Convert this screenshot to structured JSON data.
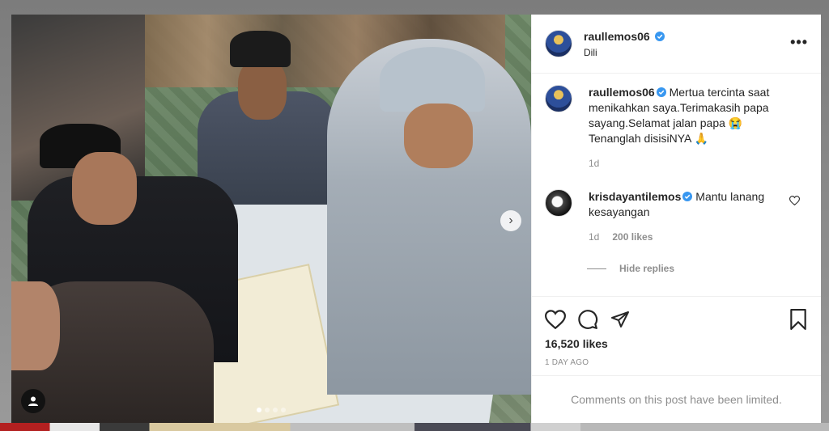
{
  "post": {
    "author": "raullemos06",
    "location": "Dili",
    "more_icon": "more-horizontal-icon",
    "carousel": {
      "dots": 4,
      "active_index": 0
    }
  },
  "caption": {
    "username": "raullemos06",
    "text": "Mertua tercinta saat menikahkan saya.Terimakasih papa sayang.Selamat jalan papa 😭 Tenanglah disisiNYA 🙏",
    "time": "1d"
  },
  "comment": {
    "username": "krisdayantilemos",
    "text": "Mantu lanang kesayangan",
    "time": "1d",
    "likes": "200 likes"
  },
  "hide_replies_label": "Hide replies",
  "actions": {
    "like_icon": "heart-icon",
    "comment_icon": "comment-icon",
    "share_icon": "share-icon",
    "save_icon": "bookmark-icon"
  },
  "likes_count": "16,520 likes",
  "posted_ago": "1 DAY AGO",
  "comments_limited": "Comments on this post have been limited.",
  "colors": {
    "verified": "#3897f0",
    "text": "#262626",
    "muted": "#8e8e8e"
  }
}
